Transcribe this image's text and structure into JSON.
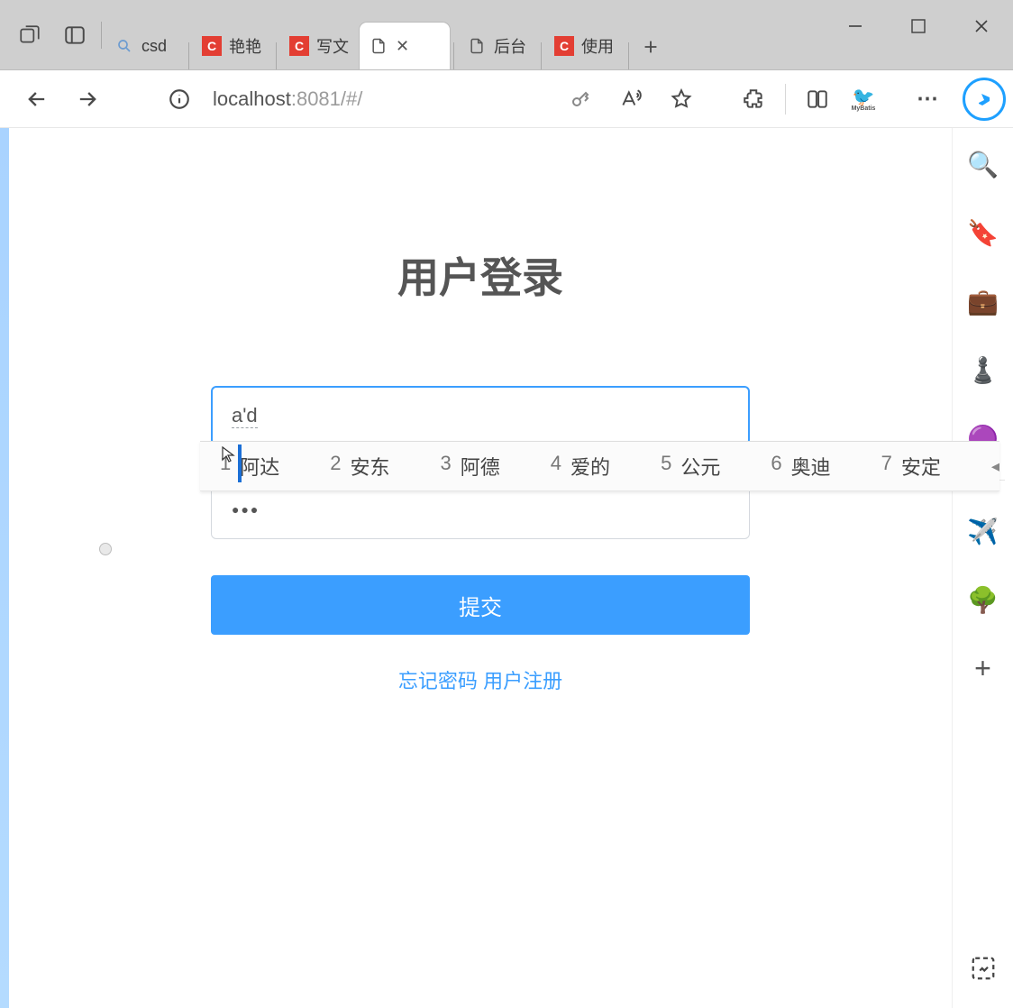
{
  "browser": {
    "tabs": [
      {
        "favicon": "search",
        "fav_char": "",
        "label": "csd"
      },
      {
        "favicon": "csdn",
        "fav_char": "C",
        "label": "艳艳"
      },
      {
        "favicon": "csdn",
        "fav_char": "C",
        "label": "写文"
      },
      {
        "favicon": "file",
        "fav_char": "",
        "label": ""
      },
      {
        "favicon": "file",
        "fav_char": "",
        "label": "后台"
      },
      {
        "favicon": "csdn",
        "fav_char": "C",
        "label": "使用"
      }
    ],
    "active_tab_index": 3,
    "address": {
      "host": "localhost",
      "rest": ":8081/#/"
    },
    "window_controls": {
      "minimize": "–",
      "maximize": "□",
      "close": "×"
    }
  },
  "sidebar_emoji": {
    "search": "🔍",
    "tag": "🔖",
    "briefcase": "💼",
    "chess": "♟️",
    "office": "🟣",
    "send": "✈️",
    "tree": "🌳",
    "plus": "+"
  },
  "page": {
    "title": "用户登录",
    "username_value": "a'd",
    "password_mask": "●●●",
    "submit_label": "提交",
    "forgot_label": "忘记密码",
    "register_label": "用户注册"
  },
  "ime": {
    "candidates": [
      {
        "num": "1",
        "text": "阿达"
      },
      {
        "num": "2",
        "text": "安东"
      },
      {
        "num": "3",
        "text": "阿德"
      },
      {
        "num": "4",
        "text": "爱的"
      },
      {
        "num": "5",
        "text": "公元"
      },
      {
        "num": "6",
        "text": "奥迪"
      },
      {
        "num": "7",
        "text": "安定"
      }
    ]
  }
}
